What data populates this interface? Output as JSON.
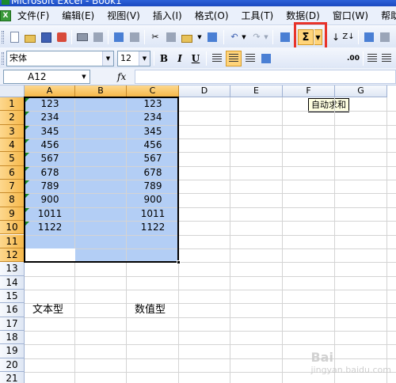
{
  "window": {
    "title": "Microsoft Excel - Book1"
  },
  "menu": [
    "文件(F)",
    "编辑(E)",
    "视图(V)",
    "插入(I)",
    "格式(O)",
    "工具(T)",
    "数据(D)",
    "窗口(W)",
    "帮助(H)"
  ],
  "toolbar": {
    "autosum_symbol": "Σ",
    "autosum_tooltip": "自动求和",
    "highlight_color": "#e8332a"
  },
  "format_toolbar": {
    "font_name": "宋体",
    "font_size": "12",
    "bold": "B",
    "italic": "I",
    "underline": "U"
  },
  "formula_bar": {
    "name_box": "A12",
    "fx": "fx",
    "content": ""
  },
  "sheet": {
    "columns": [
      "A",
      "B",
      "C",
      "D",
      "E",
      "F",
      "G"
    ],
    "selected_columns": [
      "A",
      "B",
      "C"
    ],
    "rows": [
      "1",
      "2",
      "3",
      "4",
      "5",
      "6",
      "7",
      "8",
      "9",
      "10",
      "11",
      "12",
      "13",
      "14",
      "15",
      "16",
      "17",
      "18",
      "19",
      "20",
      "21"
    ],
    "selected_rows": [
      "1",
      "2",
      "3",
      "4",
      "5",
      "6",
      "7",
      "8",
      "9",
      "10",
      "11",
      "12"
    ],
    "column_a_text_values": [
      "123",
      "234",
      "345",
      "456",
      "567",
      "678",
      "789",
      "900",
      "1011",
      "1122"
    ],
    "column_c_numeric_values": [
      "123",
      "234",
      "345",
      "456",
      "567",
      "678",
      "789",
      "900",
      "1011",
      "1122"
    ],
    "label_a16": "文本型",
    "label_c16": "数值型",
    "active_cell": "A12",
    "selection_color": "#b3cef5",
    "text_indicator_color": "#1d8a2a"
  },
  "watermark": {
    "line1": "Bai",
    "line2": "jingyan.baidu.com"
  }
}
